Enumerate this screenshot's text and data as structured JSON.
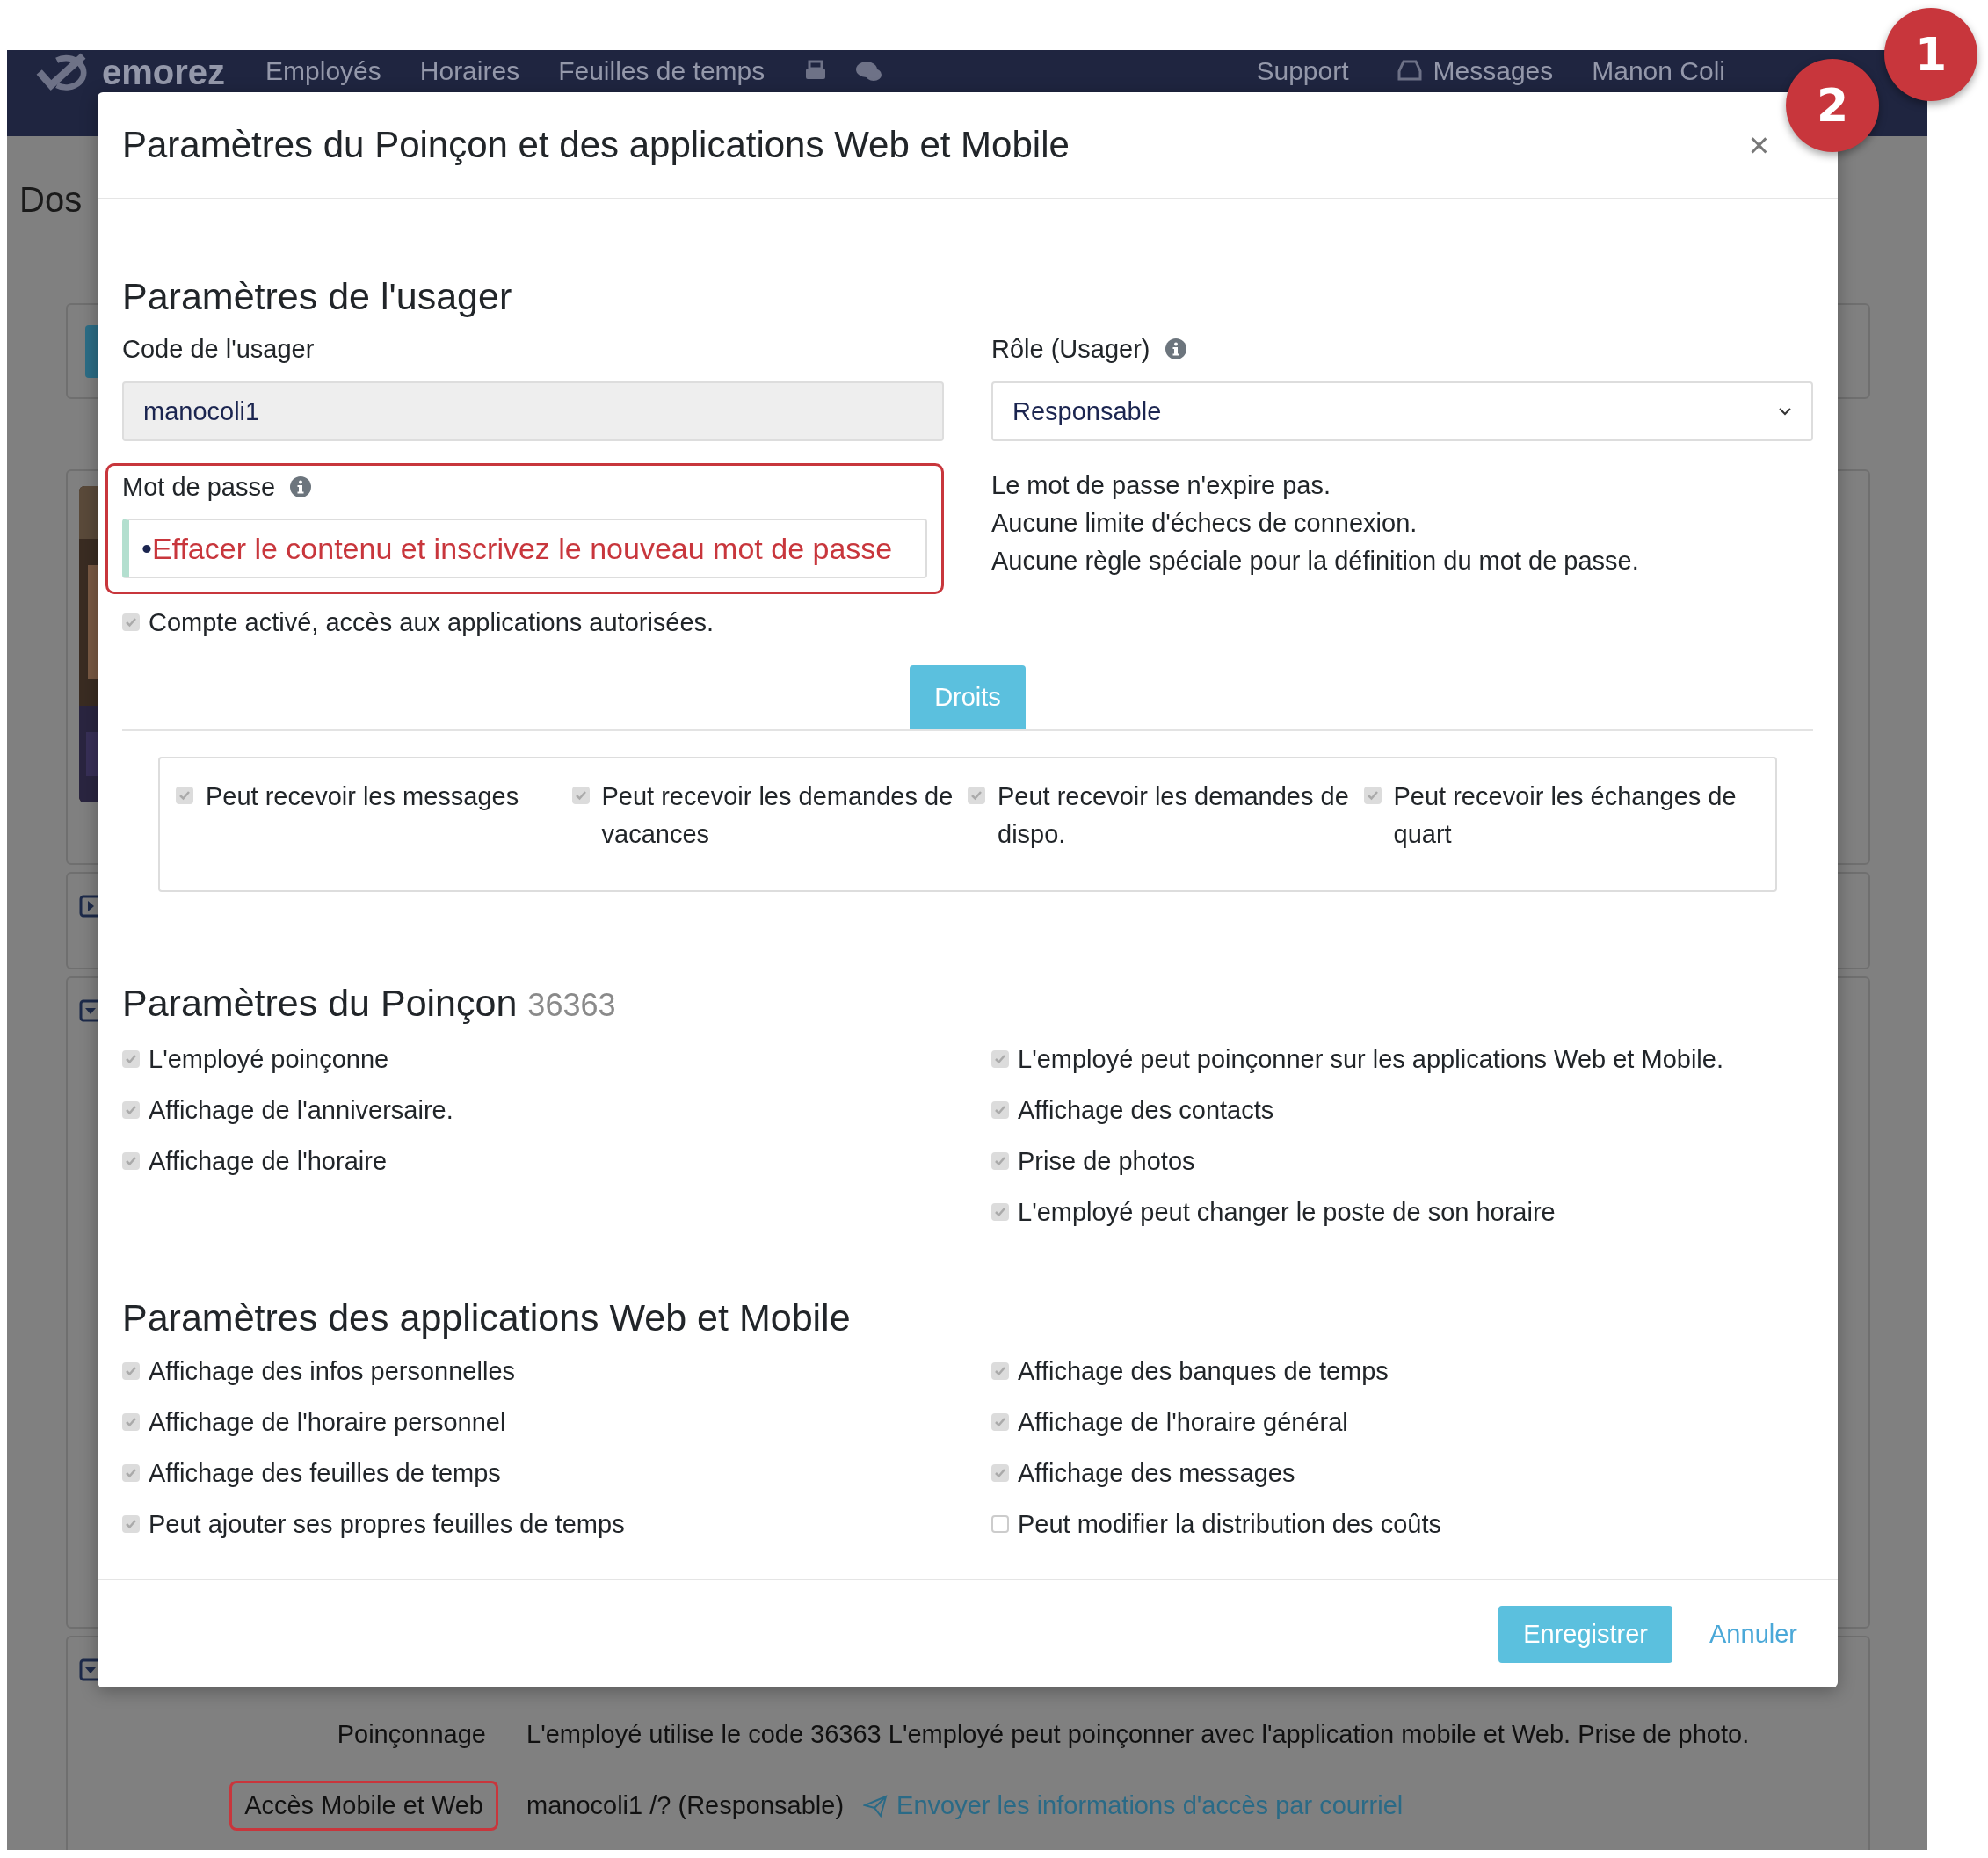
{
  "navbar": {
    "logo": "emorez",
    "items": [
      "Employés",
      "Horaires",
      "Feuilles de temps"
    ],
    "support": "Support",
    "messages": "Messages",
    "user": "Manon Coli"
  },
  "page": {
    "heading": "Dos",
    "rows": [
      {
        "label": "Poinçonnage",
        "value": "L'employé utilise le code 36363 L'employé peut poinçonner avec l'application mobile et Web. Prise de photo.",
        "highlighted": false
      },
      {
        "label": "Accès Mobile et Web",
        "value": "manocoli1 /? (Responsable)",
        "link": "Envoyer les informations d'accès par courriel",
        "highlighted": true
      }
    ]
  },
  "modal": {
    "title": "Paramètres du Poinçon et des applications Web et Mobile",
    "close": "×",
    "user": {
      "heading": "Paramètres de l'usager",
      "code_label": "Code de l'usager",
      "code_value": "manocoli1",
      "role_label": "Rôle (Usager)",
      "role_value": "Responsable",
      "password_label": "Mot de passe",
      "password_value": "•",
      "password_note": "Effacer le contenu et inscrivez le nouveau mot de passe",
      "password_highlighted": true,
      "password_rules": [
        "Le mot de passe n'expire pas.",
        "Aucune limite d'échecs de connexion.",
        "Aucune règle spéciale pour la définition du mot de passe."
      ],
      "account": {
        "label": "Compte activé, accès aux applications autorisées.",
        "checked": true
      },
      "rights_button": "Droits",
      "rights": [
        {
          "label": "Peut recevoir les messages",
          "checked": true
        },
        {
          "label": "Peut recevoir les demandes de vacances",
          "checked": true
        },
        {
          "label": "Peut recevoir les demandes de dispo.",
          "checked": true
        },
        {
          "label": "Peut recevoir les échanges de quart",
          "checked": true
        }
      ]
    },
    "punch": {
      "heading": "Paramètres du Poinçon",
      "code": "36363",
      "left": [
        {
          "label": "L'employé poinçonne",
          "checked": true
        },
        {
          "label": "Affichage de l'anniversaire.",
          "checked": true
        },
        {
          "label": "Affichage de l'horaire",
          "checked": true
        }
      ],
      "right": [
        {
          "label": "L'employé peut poinçonner sur les applications Web et Mobile.",
          "checked": true
        },
        {
          "label": "Affichage des contacts",
          "checked": true
        },
        {
          "label": "Prise de photos",
          "checked": true
        },
        {
          "label": "L'employé peut changer le poste de son horaire",
          "checked": true
        }
      ]
    },
    "apps": {
      "heading": "Paramètres des applications Web et Mobile",
      "left": [
        {
          "label": "Affichage des infos personnelles",
          "checked": true
        },
        {
          "label": "Affichage de l'horaire personnel",
          "checked": true
        },
        {
          "label": "Affichage des feuilles de temps",
          "checked": true
        },
        {
          "label": "Peut ajouter ses propres feuilles de temps",
          "checked": true
        }
      ],
      "right": [
        {
          "label": "Affichage des banques de temps",
          "checked": true
        },
        {
          "label": "Affichage de l'horaire général",
          "checked": true
        },
        {
          "label": "Affichage des messages",
          "checked": true
        },
        {
          "label": "Peut modifier la distribution des coûts",
          "checked": false
        }
      ]
    },
    "save": "Enregistrer",
    "cancel": "Annuler"
  },
  "annotations": [
    {
      "label": "1"
    },
    {
      "label": "2"
    }
  ]
}
